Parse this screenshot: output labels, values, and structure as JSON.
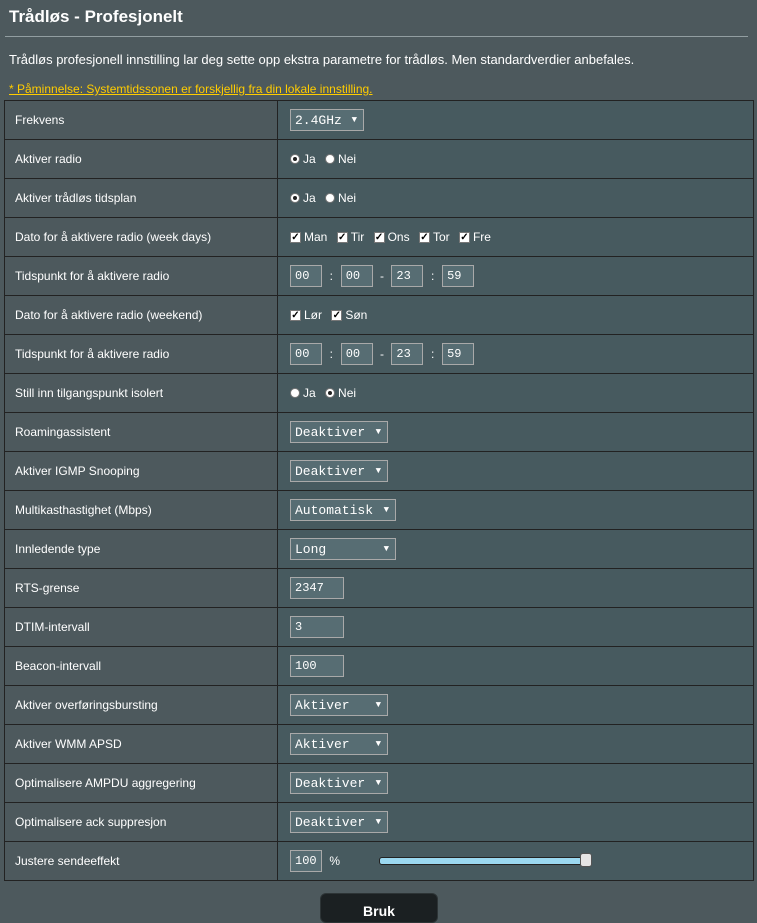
{
  "page": {
    "title": "Trådløs - Profesjonelt",
    "description": "Trådløs profesjonell innstilling lar deg sette opp ekstra parametre for trådløs. Men standardverdier anbefales.",
    "reminder": "* Påminnelse: Systemtidssonen er forskjellig fra din lokale innstilling."
  },
  "rows": {
    "frequency": {
      "label": "Frekvens",
      "value": "2.4GHz"
    },
    "enable_radio": {
      "label": "Aktiver radio",
      "yes": "Ja",
      "no": "Nei",
      "selected": "Ja"
    },
    "enable_schedule": {
      "label": "Aktiver trådløs tidsplan",
      "yes": "Ja",
      "no": "Nei",
      "selected": "Ja"
    },
    "weekdays": {
      "label": "Dato for å aktivere radio (week days)",
      "days": [
        "Man",
        "Tir",
        "Ons",
        "Tor",
        "Fre"
      ],
      "checked": [
        true,
        true,
        true,
        true,
        true
      ]
    },
    "weekday_time": {
      "label": "Tidspunkt for å aktivere radio",
      "start_h": "00",
      "start_m": "00",
      "end_h": "23",
      "end_m": "59",
      "colon": ":",
      "dash": "-"
    },
    "weekend": {
      "label": "Dato for å aktivere radio (weekend)",
      "days": [
        "Lør",
        "Søn"
      ],
      "checked": [
        true,
        true
      ]
    },
    "weekend_time": {
      "label": "Tidspunkt for å aktivere radio",
      "start_h": "00",
      "start_m": "00",
      "end_h": "23",
      "end_m": "59",
      "colon": ":",
      "dash": "-"
    },
    "ap_isolated": {
      "label": "Still inn tilgangspunkt isolert",
      "yes": "Ja",
      "no": "Nei",
      "selected": "Nei"
    },
    "roaming": {
      "label": "Roamingassistent",
      "value": "Deaktiver"
    },
    "igmp": {
      "label": "Aktiver IGMP Snooping",
      "value": "Deaktiver"
    },
    "multicast_rate": {
      "label": "Multikasthastighet (Mbps)",
      "value": "Automatisk"
    },
    "preamble": {
      "label": "Innledende type",
      "value": "Long"
    },
    "rts": {
      "label": "RTS-grense",
      "value": "2347"
    },
    "dtim": {
      "label": "DTIM-intervall",
      "value": "3"
    },
    "beacon": {
      "label": "Beacon-intervall",
      "value": "100"
    },
    "bursting": {
      "label": "Aktiver overføringsbursting",
      "value": "Aktiver"
    },
    "wmm_apsd": {
      "label": "Aktiver WMM APSD",
      "value": "Aktiver"
    },
    "ampdu": {
      "label": "Optimalisere AMPDU aggregering",
      "value": "Deaktiver"
    },
    "ack": {
      "label": "Optimalisere ack suppresjon",
      "value": "Deaktiver"
    },
    "tx_power": {
      "label": "Justere sendeeffekt",
      "value": "100",
      "unit": "%",
      "level_percent": 100
    }
  },
  "apply_button": "Bruk",
  "icons": {
    "dropdown": "chevron-down-icon",
    "radio": "radio-icon",
    "checkbox": "checkbox-icon"
  }
}
